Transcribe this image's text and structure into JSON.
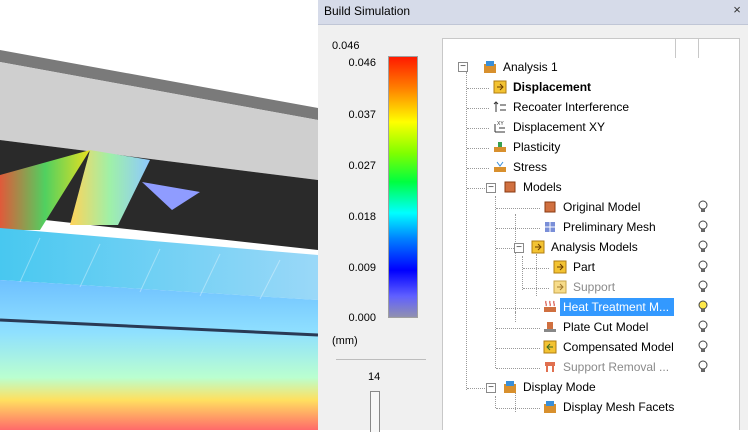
{
  "window": {
    "title": "Build Simulation",
    "close_glyph": "×"
  },
  "legend": {
    "top_value": "0.046",
    "ticks": [
      "0.046",
      "0.037",
      "0.027",
      "0.018",
      "0.009",
      "0.000"
    ],
    "unit": "(mm)",
    "layer_value": "14"
  },
  "tree": {
    "nodes": [
      {
        "label": "Analysis 1",
        "icon": "analysis-icon"
      },
      {
        "label": "Displacement",
        "icon": "displacement-icon",
        "bold": true
      },
      {
        "label": "Recoater Interference",
        "icon": "recoater-icon"
      },
      {
        "label": "Displacement XY",
        "icon": "displacement-xy-icon"
      },
      {
        "label": "Plasticity",
        "icon": "plasticity-icon"
      },
      {
        "label": "Stress",
        "icon": "stress-icon"
      },
      {
        "label": "Models",
        "icon": "models-icon"
      },
      {
        "label": "Original Model",
        "icon": "original-model-icon"
      },
      {
        "label": "Preliminary Mesh",
        "icon": "mesh-icon"
      },
      {
        "label": "Analysis Models",
        "icon": "analysis-models-icon"
      },
      {
        "label": "Part",
        "icon": "part-icon"
      },
      {
        "label": "Support",
        "icon": "support-icon",
        "grey": true
      },
      {
        "label": "Heat Treatment M...",
        "icon": "heat-treatment-icon",
        "selected": true
      },
      {
        "label": "Plate Cut Model",
        "icon": "plate-cut-icon"
      },
      {
        "label": "Compensated Model",
        "icon": "compensated-icon"
      },
      {
        "label": "Support Removal ...",
        "icon": "support-removal-icon",
        "grey": true
      },
      {
        "label": "Display Mode",
        "icon": "display-mode-icon"
      },
      {
        "label": "Display Mesh Facets",
        "icon": "mesh-facets-icon"
      }
    ]
  },
  "colors": {
    "selection": "#3399ff",
    "bulb_on": "#ffe94a",
    "bulb_off": "#ffffff"
  }
}
